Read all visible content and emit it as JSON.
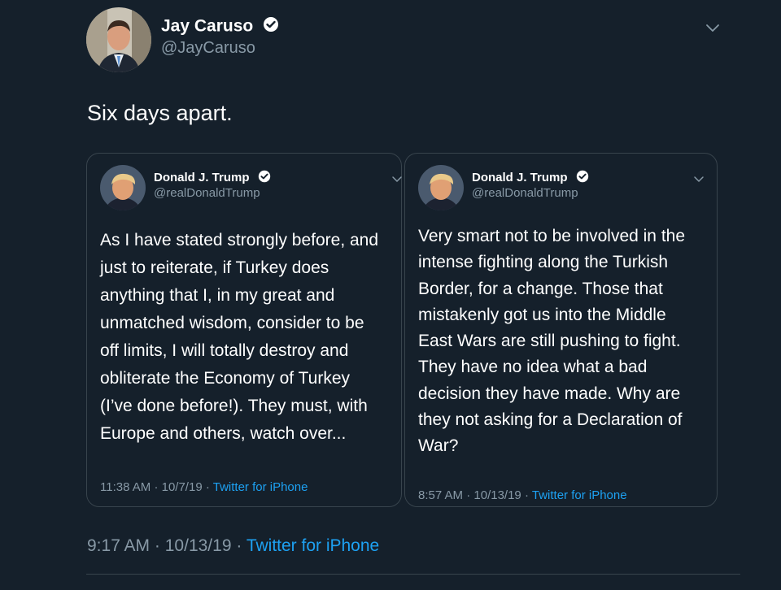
{
  "author": {
    "display_name": "Jay Caruso",
    "handle": "@JayCaruso"
  },
  "tweet": {
    "text": "Six days apart.",
    "time": "9:17 AM",
    "date": "10/13/19",
    "source": "Twitter for iPhone"
  },
  "quoted": [
    {
      "display_name": "Donald J. Trump",
      "handle": "@realDonaldTrump",
      "lines": [
        "As I have stated strongly before, and",
        "just to reiterate, if Turkey does",
        "anything that I, in my great and",
        "unmatched wisdom, consider to be",
        "off limits, I will totally destroy and",
        "obliterate the Economy of Turkey",
        "(I’ve done before!). They must, with",
        "Europe and others, watch over..."
      ],
      "time": "11:38 AM",
      "date": "10/7/19",
      "source": "Twitter for iPhone"
    },
    {
      "display_name": "Donald J. Trump",
      "handle": "@realDonaldTrump",
      "lines": [
        "Very smart not to be involved in the",
        "intense fighting along the Turkish",
        "Border, for a change. Those that",
        "mistakenly got us into the Middle",
        "East Wars are still pushing to fight.",
        "They have no idea what a bad",
        "decision they have made. Why are",
        "they not asking for a Declaration of",
        "War?"
      ],
      "time": "8:57 AM",
      "date": "10/13/19",
      "source": "Twitter for iPhone"
    }
  ],
  "separator": "·",
  "colors": {
    "background": "#15202b",
    "border": "#38444d",
    "secondary_text": "#8899a6",
    "link": "#1da1f2"
  },
  "icons": {
    "verified": "verified-badge-icon",
    "more": "chevron-down-icon"
  }
}
